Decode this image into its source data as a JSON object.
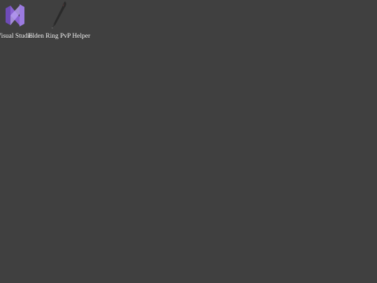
{
  "desktop": {
    "background_color": "#404040",
    "icons": [
      {
        "label": "Visual Studio",
        "icon": "visual-studio-icon",
        "color": "#8661C5"
      },
      {
        "label": "Elden Ring PvP Helper",
        "icon": "sword-icon",
        "color": "#2b2b2b"
      }
    ]
  }
}
